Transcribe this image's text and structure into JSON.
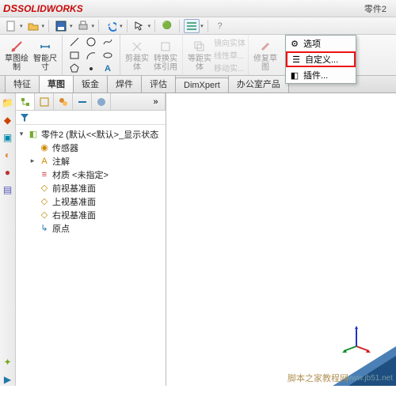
{
  "app": {
    "brand": "SOLIDWORKS",
    "doc_title": "零件2"
  },
  "ribbon": {
    "sketch_btn": "草图绘制",
    "smart_dim_btn": "智能尺寸",
    "trim_btn": "剪裁实体",
    "convert_btn": "转换实体引用",
    "offset_btn": "等距实体",
    "mirror_btn": "镜向实体",
    "linear_btn": "线性草...",
    "move_btn": "移动实...",
    "repair_btn": "修复草图"
  },
  "options_menu": {
    "options": "选项",
    "customize": "自定义...",
    "addins": "插件..."
  },
  "tabs": {
    "features": "特征",
    "sketch": "草图",
    "sheetmetal": "钣金",
    "weldments": "焊件",
    "evaluate": "评估",
    "dimxpert": "DimXpert",
    "office": "办公室产品"
  },
  "tree": {
    "root": "零件2 (默认<<默认>_显示状态",
    "sensors": "传感器",
    "annotations": "注解",
    "material": "材质 <未指定>",
    "front": "前视基准面",
    "top": "上视基准面",
    "right": "右视基准面",
    "origin": "原点"
  },
  "watermark": "www.jb51.net",
  "watermark2": "脚本之家教程网",
  "colors": {
    "accent_red": "#c80a0a",
    "axis_x": "#d02020",
    "axis_y": "#109030",
    "axis_z": "#2030d0"
  }
}
